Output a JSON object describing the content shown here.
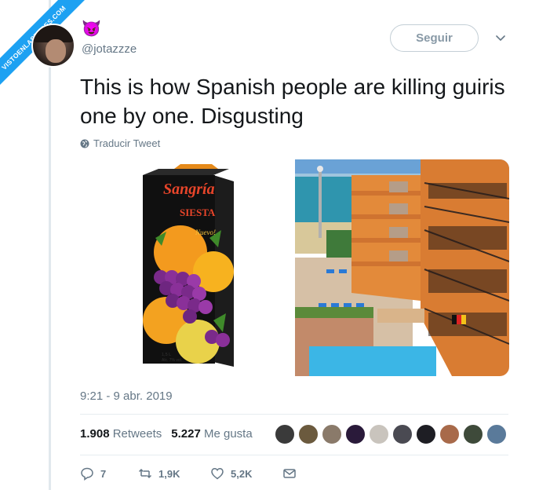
{
  "watermark": "VISTOENLASREDES.COM",
  "author": {
    "emoji": "😈",
    "handle": "@jotazzze"
  },
  "follow_label": "Seguir",
  "tweet": {
    "text": "This is how Spanish people are killing guiris one by one. Disgusting",
    "translate_label": "Traducir Tweet",
    "timestamp": "9:21 - 9 abr. 2019"
  },
  "carton": {
    "brand": "Sangría",
    "sub": "SIESTA",
    "nuevo": "Nuevo!",
    "volume": "1,5 L",
    "alc": "Alc. 7% vol."
  },
  "stats": {
    "retweets_count": "1.908",
    "retweets_label": "Retweets",
    "likes_count": "5.227",
    "likes_label": "Me gusta"
  },
  "actions": {
    "replies": "7",
    "retweets": "1,9K",
    "likes": "5,2K"
  },
  "colors": {
    "accent": "#1da1f2",
    "muted": "#657786"
  }
}
